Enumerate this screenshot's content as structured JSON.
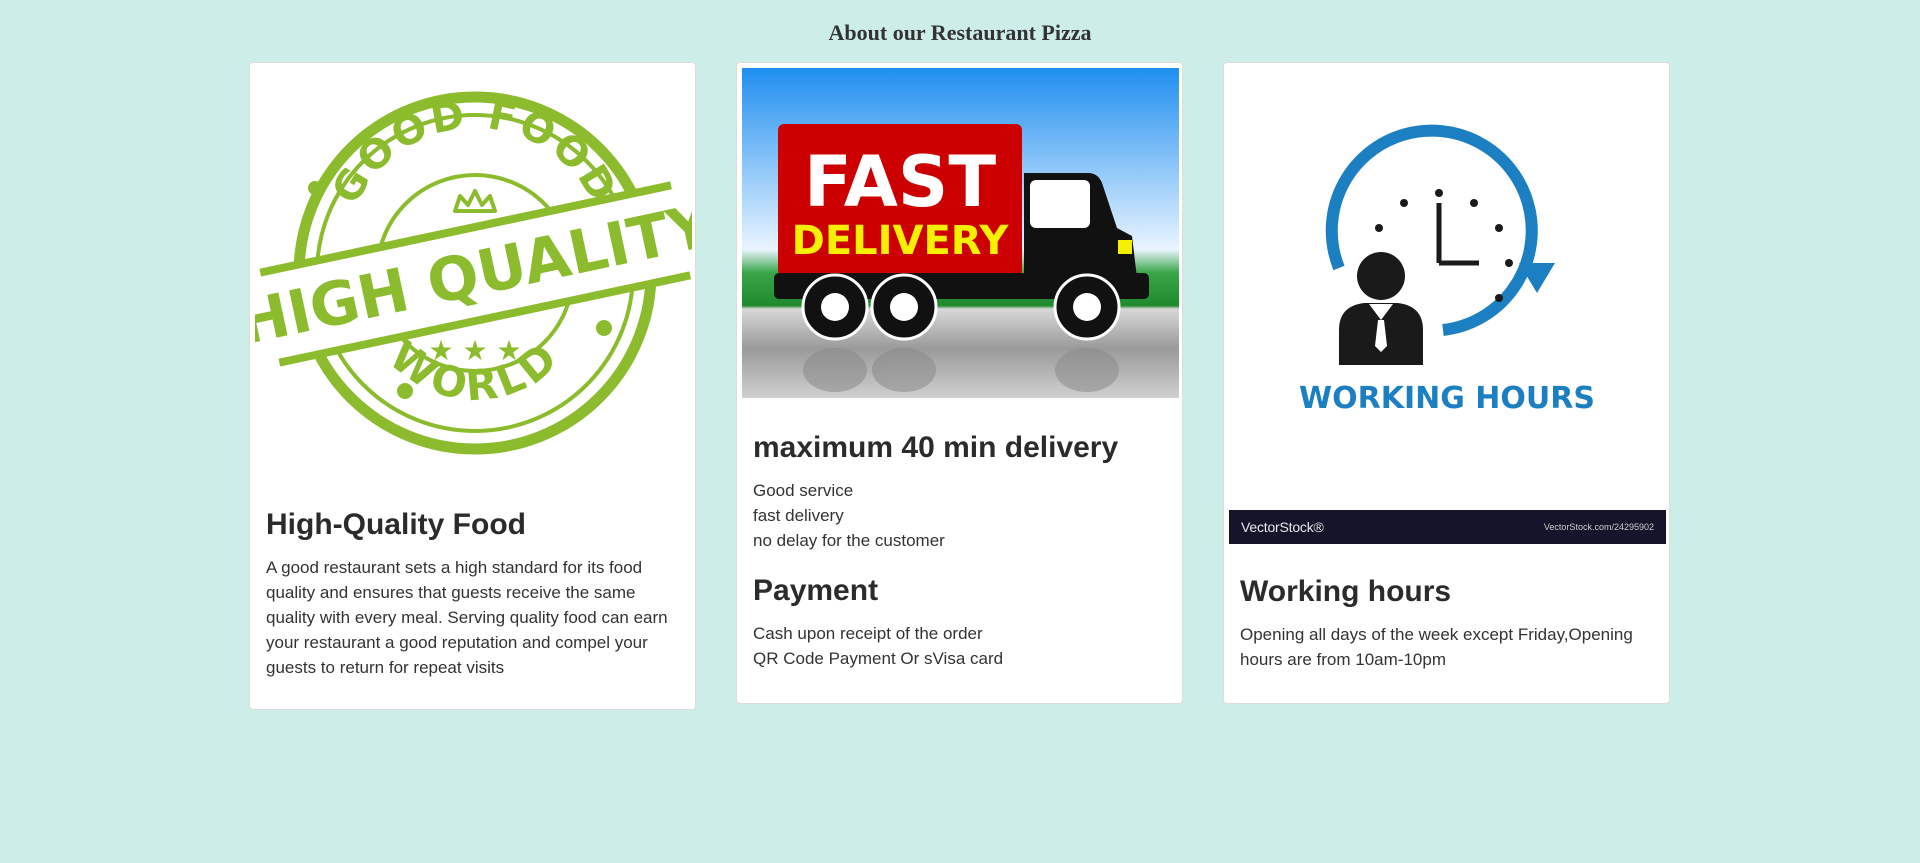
{
  "page": {
    "title": "About our Restaurant Pizza",
    "background_color": "#cdeee8"
  },
  "cards": [
    {
      "image_icon": "good-food-high-quality-stamp-icon",
      "stamp_text": {
        "top": "GOOD FOOD",
        "middle": "HIGH QUALITY",
        "bottom": "WORLD"
      },
      "title": "High-Quality Food",
      "text": "A good restaurant sets a high standard for its food quality and ensures that guests receive the same quality with every meal. Serving quality food can earn your restaurant a good reputation and compel your guests to return for repeat visits",
      "accent_color": "#8cbb2d"
    },
    {
      "image_icon": "fast-delivery-truck-icon",
      "image_text": {
        "line1": "FAST",
        "line2": "DELIVERY"
      },
      "title": "maximum 40 min delivery",
      "lines": [
        "Good service",
        "fast delivery",
        "no delay for the customer"
      ],
      "title2": "Payment",
      "lines2": [
        "Cash upon receipt of the order",
        "QR Code Payment Or sVisa card"
      ],
      "accent_color": "#cc0000"
    },
    {
      "image_icon": "working-hours-clock-icon",
      "image_text": "WORKING HOURS",
      "watermark_brand": "VectorStock®",
      "watermark_url": "VectorStock.com/24295902",
      "title": "Working hours",
      "text": "Opening all days of the week except Friday,Opening hours are from 10am-10pm",
      "accent_color": "#1b7fc1"
    }
  ]
}
